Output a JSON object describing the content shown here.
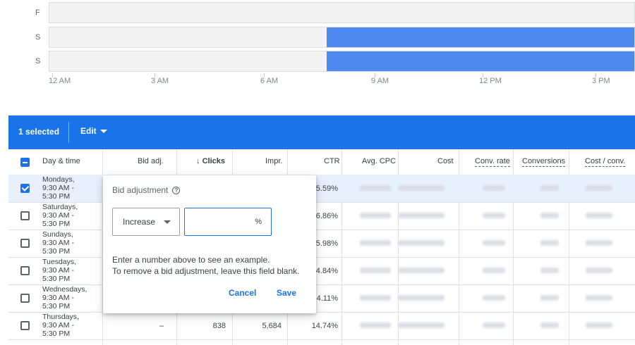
{
  "schedule": {
    "rows": [
      {
        "day": "F",
        "fill_start_hour": null
      },
      {
        "day": "S",
        "fill_start_hour": 9.5
      },
      {
        "day": "S",
        "fill_start_hour": 9.5
      }
    ],
    "axis_labels": [
      "12 AM",
      "3 AM",
      "6 AM",
      "9 AM",
      "12 PM",
      "3 PM"
    ],
    "fill_color": "#4e89f0"
  },
  "toolbar": {
    "selected_label": "1 selected",
    "edit_label": "Edit",
    "color": "#1a73e8"
  },
  "table": {
    "headers": {
      "day_time": "Day & time",
      "bid_adj": "Bid adj.",
      "clicks": "Clicks",
      "sort_icon": "↓",
      "impr": "Impr.",
      "ctr": "CTR",
      "avg_cpc": "Avg. CPC",
      "cost": "Cost",
      "conv_rate": "Conv. rate",
      "conversions": "Conversions",
      "cost_conv": "Cost / conv."
    },
    "rows": [
      {
        "day": "Mondays,",
        "start": "9:30 AM -",
        "end": "5:30 PM",
        "checked": true,
        "bid": "",
        "clicks": "",
        "impr": "",
        "ctr": "5.59%"
      },
      {
        "day": "Saturdays,",
        "start": "9:30 AM -",
        "end": "5:30 PM",
        "checked": false,
        "bid": "",
        "clicks": "",
        "impr": "",
        "ctr": "6.86%"
      },
      {
        "day": "Sundays,",
        "start": "9:30 AM -",
        "end": "5:30 PM",
        "checked": false,
        "bid": "",
        "clicks": "",
        "impr": "",
        "ctr": "5.98%"
      },
      {
        "day": "Tuesdays,",
        "start": "9:30 AM -",
        "end": "5:30 PM",
        "checked": false,
        "bid": "",
        "clicks": "",
        "impr": "",
        "ctr": "4.84%"
      },
      {
        "day": "Wednesdays,",
        "start": "9:30 AM -",
        "end": "5:30 PM",
        "checked": false,
        "bid": "",
        "clicks": "",
        "impr": "",
        "ctr": "4.11%"
      },
      {
        "day": "Thursdays,",
        "start": "9:30 AM -",
        "end": "5:30 PM",
        "checked": false,
        "bid": "–",
        "clicks": "838",
        "impr": "5,684",
        "ctr": "14.74%"
      }
    ]
  },
  "popup": {
    "title": "Bid adjustment",
    "select_value": "Increase",
    "input_value": "",
    "input_suffix": "%",
    "hint_line1": "Enter a number above to see an example.",
    "hint_line2": "To remove a bid adjustment, leave this field blank.",
    "cancel_label": "Cancel",
    "save_label": "Save"
  }
}
